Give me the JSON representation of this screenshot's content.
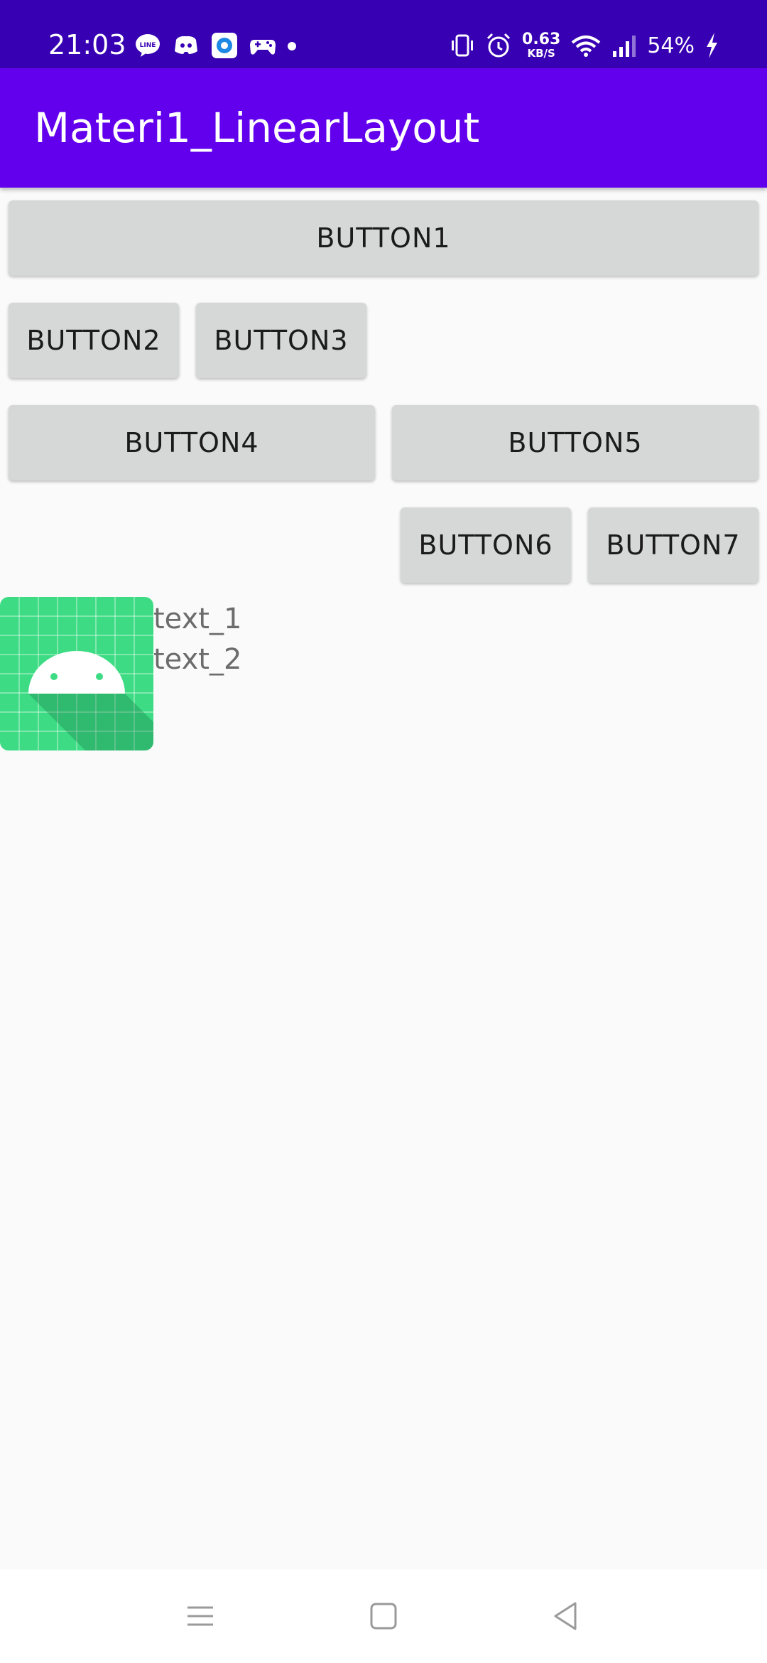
{
  "status_bar": {
    "time": "21:03",
    "left_icons": [
      "line-icon",
      "discord-icon",
      "browser-icon",
      "gamepad-icon",
      "dot-icon"
    ],
    "net_speed_value": "0.63",
    "net_speed_unit": "KB/S",
    "battery": "54%",
    "right_icons": [
      "vibrate-icon",
      "alarm-icon",
      "wifi-icon",
      "signal-icon",
      "charging-icon"
    ],
    "bg_color": "#3700b3"
  },
  "app_bar": {
    "title": "Materi1_LinearLayout",
    "bg_color": "#6200ee"
  },
  "buttons": {
    "b1": "BUTTON1",
    "b2": "BUTTON2",
    "b3": "BUTTON3",
    "b4": "BUTTON4",
    "b5": "BUTTON5",
    "b6": "BUTTON6",
    "b7": "BUTTON7"
  },
  "content": {
    "image_icon": "android-launcher-icon",
    "text_1": "text_1",
    "text_2": "text_2"
  },
  "nav_bar": {
    "icons": [
      "menu-icon",
      "home-icon",
      "back-icon"
    ]
  }
}
